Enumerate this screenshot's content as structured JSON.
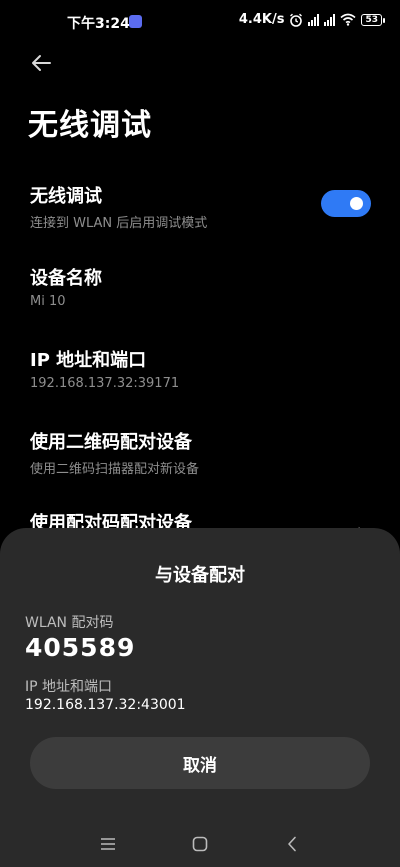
{
  "status_bar": {
    "time": "下午3:24",
    "net_speed": "4.4K/s",
    "battery": "53"
  },
  "page": {
    "title": "无线调试"
  },
  "settings": [
    {
      "title": "无线调试",
      "subtitle": "连接到 WLAN 后启用调试模式",
      "toggle_on": true
    },
    {
      "title": "设备名称",
      "subtitle": "Mi 10"
    },
    {
      "title": "IP 地址和端口",
      "subtitle": "192.168.137.32:39171"
    },
    {
      "title": "使用二维码配对设备",
      "subtitle": "使用二维码扫描器配对新设备"
    },
    {
      "title": "使用配对码配对设备"
    }
  ],
  "dialog": {
    "title": "与设备配对",
    "code_label": "WLAN 配对码",
    "code": "405589",
    "ip_label": "IP 地址和端口",
    "ip_value": "192.168.137.32:43001",
    "cancel_label": "取消"
  },
  "colors": {
    "accent": "#2f7af5",
    "sheet_bg": "#2a2a2a",
    "button_bg": "#3c3c3c"
  },
  "icons": {
    "back": "arrow-left-icon",
    "alarm": "alarm-icon",
    "wifi": "wifi-icon",
    "nav_menu": "menu-icon",
    "nav_home": "home-icon",
    "nav_back": "nav-back-icon"
  }
}
